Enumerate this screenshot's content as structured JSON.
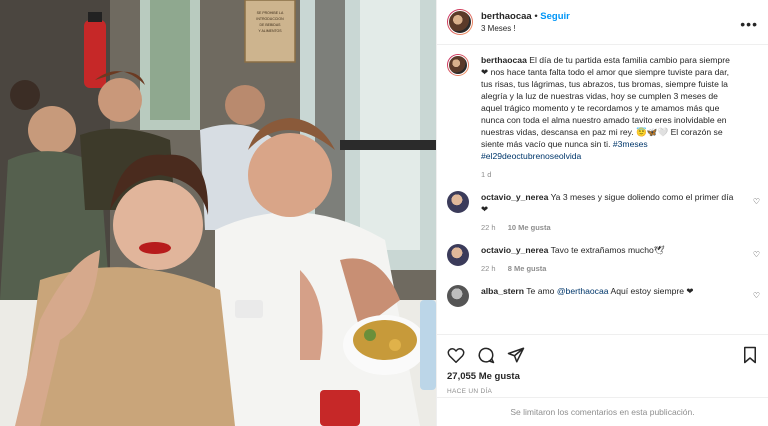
{
  "post": {
    "username": "berthaocaa",
    "follow_label": "Seguir",
    "subtitle": "3 Meses !",
    "more_icon": "more-icon",
    "caption_user": "berthaocaa",
    "caption_text": "El día de tu partida esta familia cambio para siempre❤ nos hace tanta falta todo el amor que siempre tuviste para dar, tus risas, tus lágrimas, tus abrazos, tus bromas, siempre fuiste la alegría y la luz de nuestras vidas, hoy se cumplen 3 meses de aquel trágico momento y te recordamos y te amamos más que nunca con toda el alma nuestro amado tavito eres inolvidable en nuestras vidas, descansa en paz mi rey. 😇🦋🤍 El corazón se siente más vacío que nunca sin ti.",
    "caption_tags": "#3meses #el29deoctubrenoseolvida",
    "caption_time": "1 d"
  },
  "comments": [
    {
      "user": "octavio_y_nerea",
      "text": "Ya 3 meses y sigue doliendo como el primer día❤",
      "time": "22 h",
      "likes": "10 Me gusta"
    },
    {
      "user": "octavio_y_nerea",
      "text": "Tavo te extrañamos mucho🕊",
      "time": "22 h",
      "likes": "8 Me gusta"
    },
    {
      "user": "alba_stern",
      "text_prefix": "Te amo ",
      "mention": "@berthaocaa",
      "text_suffix": " Aquí estoy siempre ❤"
    }
  ],
  "footer": {
    "likes": "27,055 Me gusta",
    "ago": "HACE UN DÍA",
    "comments_limited": "Se limitaron los comentarios en esta publicación."
  },
  "colors": {
    "accent": "#0095f6",
    "heart": "#ed4956",
    "muted": "#8e8e8e"
  },
  "photo_signs": {
    "sign_text": "SE PROHIBE LA INTRODUCCION DE BEBIDAS Y ALIMENTOS AJENOS A ESTE ESTABLECIMIENTO"
  }
}
